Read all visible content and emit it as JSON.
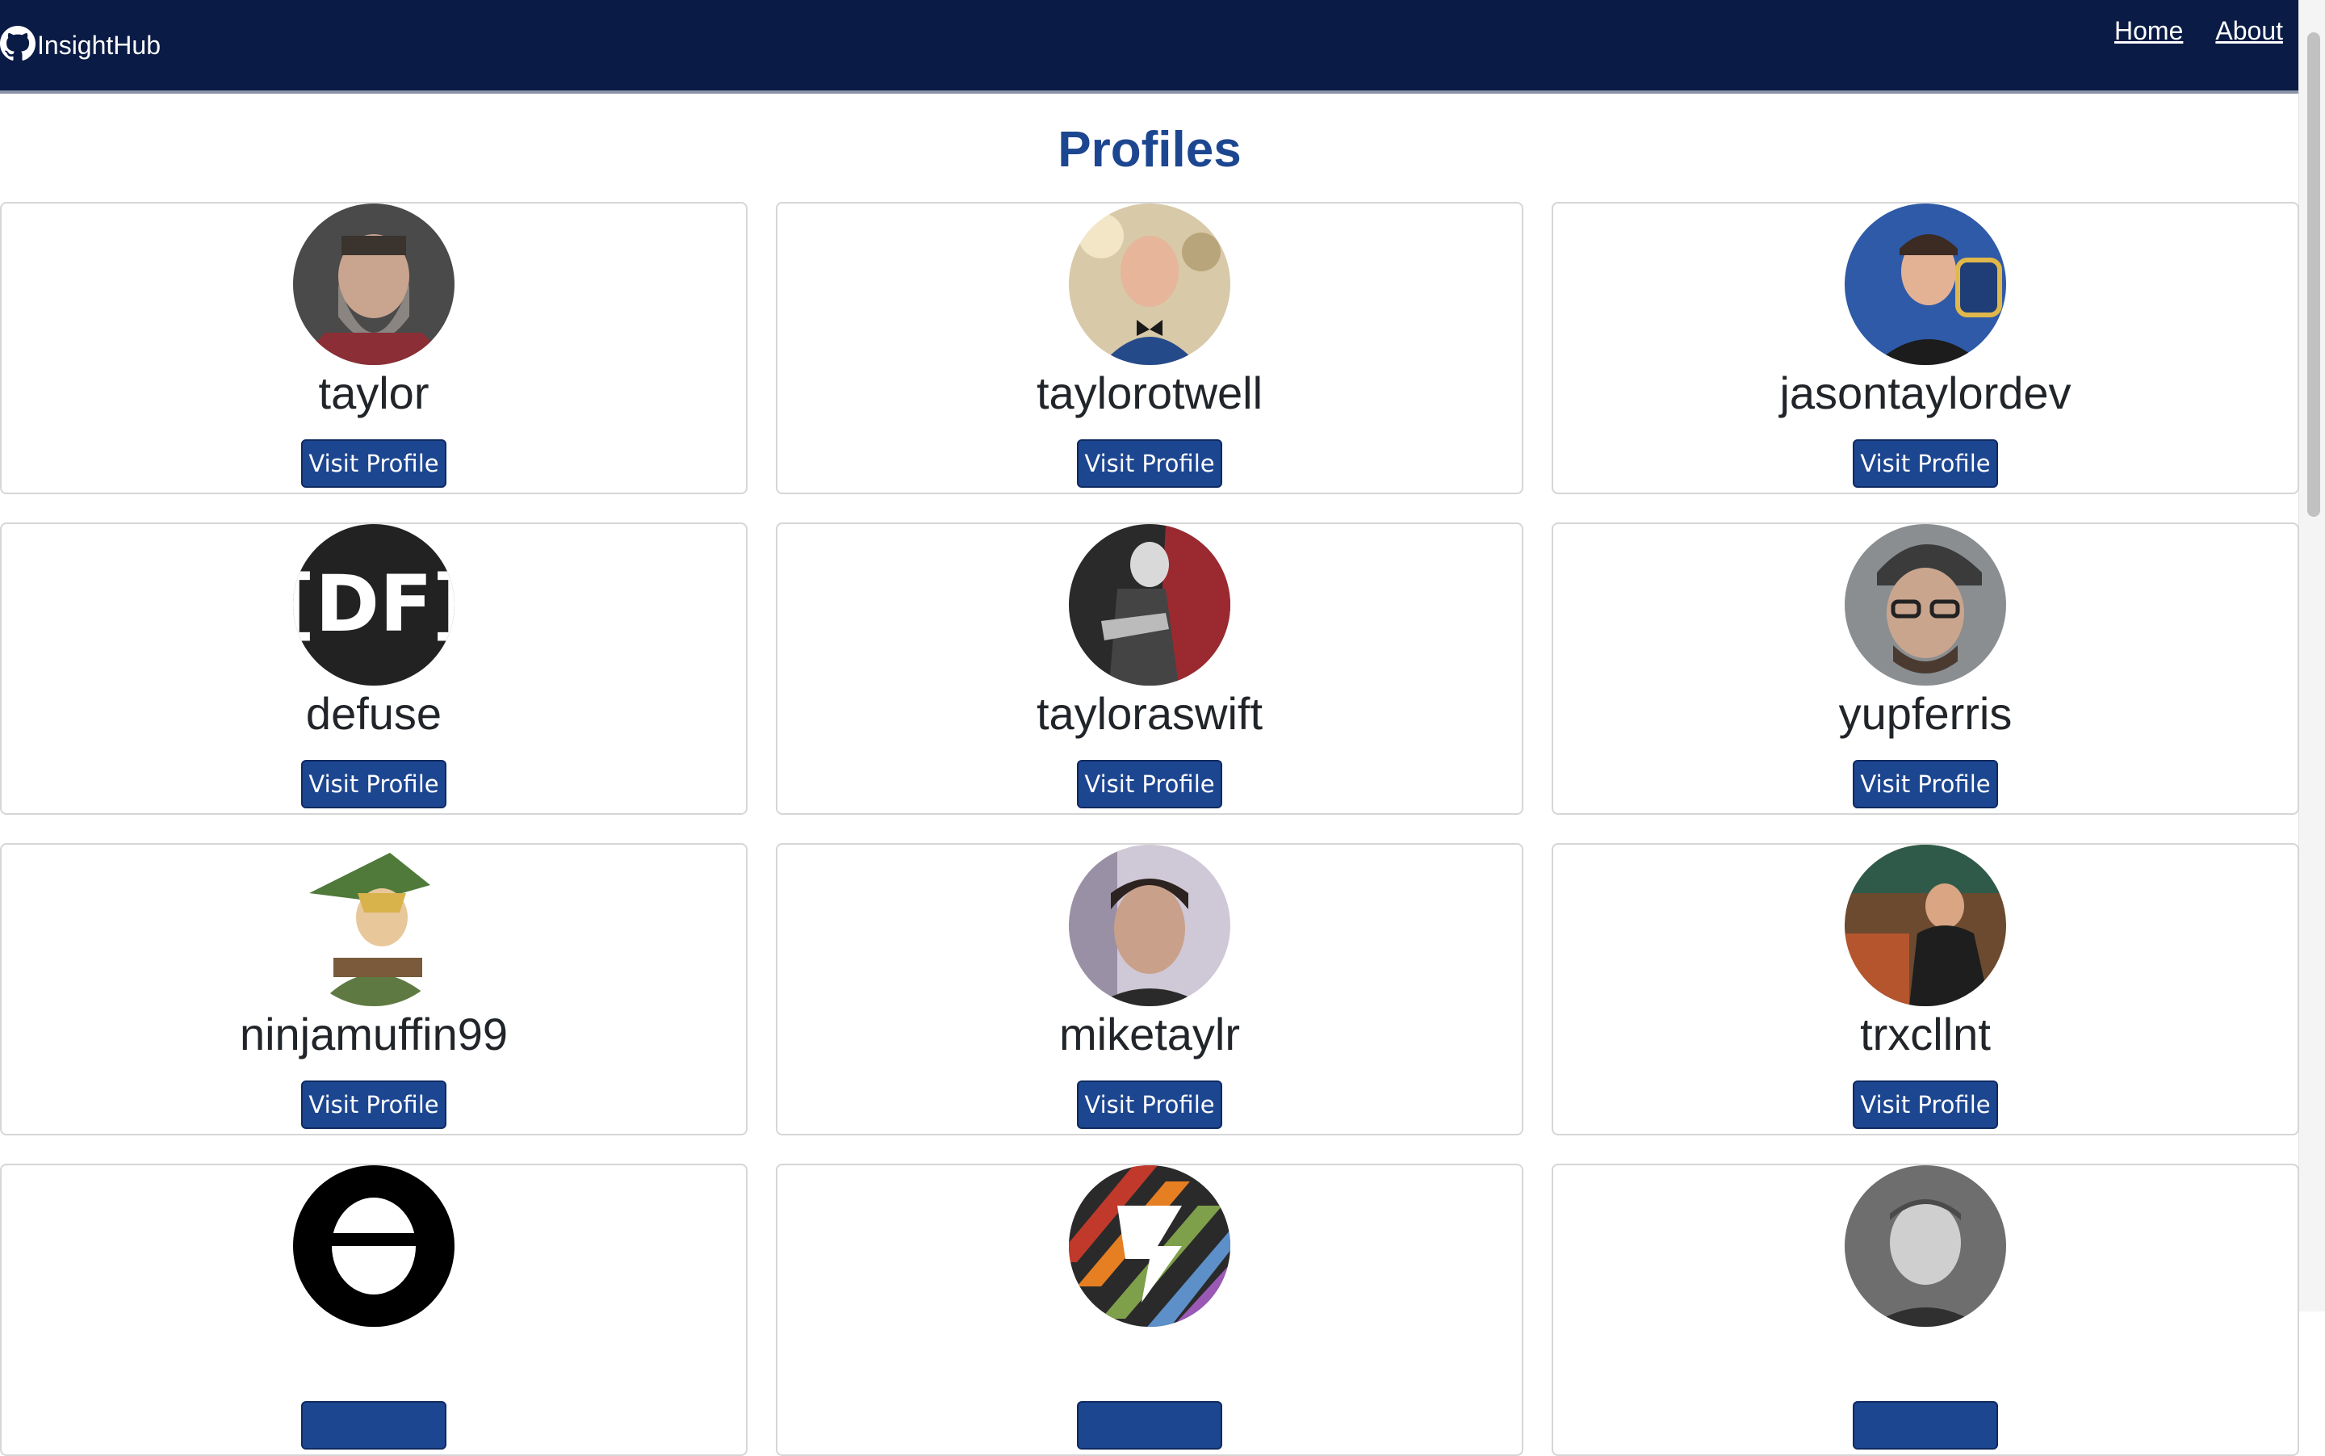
{
  "header": {
    "brand": "InsightHub",
    "brand_icon": "github-icon",
    "nav": [
      "Home",
      "About"
    ]
  },
  "page": {
    "title": "Profiles"
  },
  "profiles": [
    {
      "username": "taylor",
      "button": "Visit Profile"
    },
    {
      "username": "taylorotwell",
      "button": "Visit Profile"
    },
    {
      "username": "jasontaylordev",
      "button": "Visit Profile"
    },
    {
      "username": "defuse",
      "button": "Visit Profile"
    },
    {
      "username": "tayloraswift",
      "button": "Visit Profile"
    },
    {
      "username": "yupferris",
      "button": "Visit Profile"
    },
    {
      "username": "ninjamuffin99",
      "button": "Visit Profile"
    },
    {
      "username": "miketaylr",
      "button": "Visit Profile"
    },
    {
      "username": "trxcllnt",
      "button": "Visit Profile"
    },
    {
      "username": "",
      "button": ""
    },
    {
      "username": "",
      "button": ""
    },
    {
      "username": "",
      "button": ""
    }
  ],
  "colors": {
    "navbar": "#0a1b45",
    "accent": "#1d4690",
    "button": "#1d4690"
  }
}
